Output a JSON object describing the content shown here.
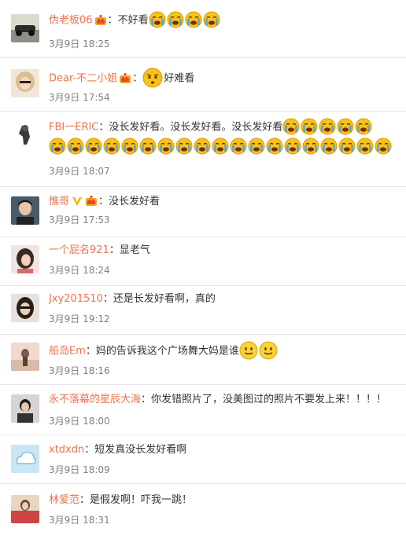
{
  "comments": [
    {
      "user": "伪老板06",
      "badge": "crown-badge",
      "vip": false,
      "colon": "：",
      "text": "不好看",
      "emoji": [
        "crying-emoji",
        "crying-emoji",
        "crying-emoji",
        "crying-emoji"
      ],
      "emoji2": [],
      "time": "3月9日  18:25"
    },
    {
      "user": "Dear-不二小姐",
      "badge": "crown-badge",
      "vip": false,
      "colon": "：",
      "text": "好难看",
      "emoji_before_text": [
        "puzzled-emoji"
      ],
      "emoji": [],
      "emoji2": [],
      "time": "3月9日  17:54"
    },
    {
      "user": "FBI一ERIC",
      "badge": "",
      "vip": false,
      "colon": "：",
      "text": "没长发好看。没长发好看。没长发好看",
      "emoji": [
        "crying-emoji",
        "crying-emoji",
        "crying-emoji",
        "crying-emoji",
        "crying-emoji"
      ],
      "emoji2": [
        "crying-emoji",
        "crying-emoji",
        "crying-emoji",
        "crying-emoji",
        "crying-emoji",
        "crying-emoji",
        "crying-emoji",
        "crying-emoji",
        "crying-emoji",
        "crying-emoji",
        "crying-emoji",
        "crying-emoji",
        "crying-emoji",
        "crying-emoji",
        "crying-emoji",
        "crying-emoji",
        "crying-emoji",
        "crying-emoji",
        "crying-emoji"
      ],
      "time": "3月9日  18:07"
    },
    {
      "user": "憔哥",
      "badge": "crown-badge",
      "vip": true,
      "colon": "：",
      "text": "没长发好看",
      "emoji": [],
      "emoji2": [],
      "time": "3月9日  17:53"
    },
    {
      "user": "一个屁名921",
      "badge": "",
      "vip": false,
      "colon": "：",
      "text": "显老气",
      "emoji": [],
      "emoji2": [],
      "time": "3月9日  18:24"
    },
    {
      "user": "Jxy201510",
      "badge": "",
      "vip": false,
      "colon": "：",
      "text": "还是长发好看啊，真的",
      "emoji": [],
      "emoji2": [],
      "time": "3月9日  19:12"
    },
    {
      "user": "船岛Em",
      "badge": "",
      "vip": false,
      "colon": "：",
      "text": "妈的告诉我这个广场舞大妈是谁",
      "emoji": [
        "smile-emoji",
        "smile-emoji"
      ],
      "emoji2": [],
      "time": "3月9日  18:16"
    },
    {
      "user": "永不落幕的星辰大海",
      "badge": "",
      "vip": false,
      "colon": "：",
      "text": "你发错照片了，没美图过的照片不要发上来！！！！",
      "emoji": [],
      "emoji2": [],
      "time": "3月9日  18:00"
    },
    {
      "user": "xtdxdn",
      "badge": "",
      "vip": false,
      "colon": "：",
      "text": "短发真没长发好看啊",
      "emoji": [],
      "emoji2": [],
      "time": "3月9日  18:09"
    },
    {
      "user": "林爱范",
      "badge": "",
      "vip": false,
      "colon": "：",
      "text": "是假发啊！吓我一跳！",
      "emoji": [],
      "emoji2": [],
      "time": "3月9日  18:31"
    }
  ],
  "colors": {
    "username": "#eb7350",
    "text": "#333333",
    "time": "#808080",
    "divider": "#e6e6e6"
  }
}
